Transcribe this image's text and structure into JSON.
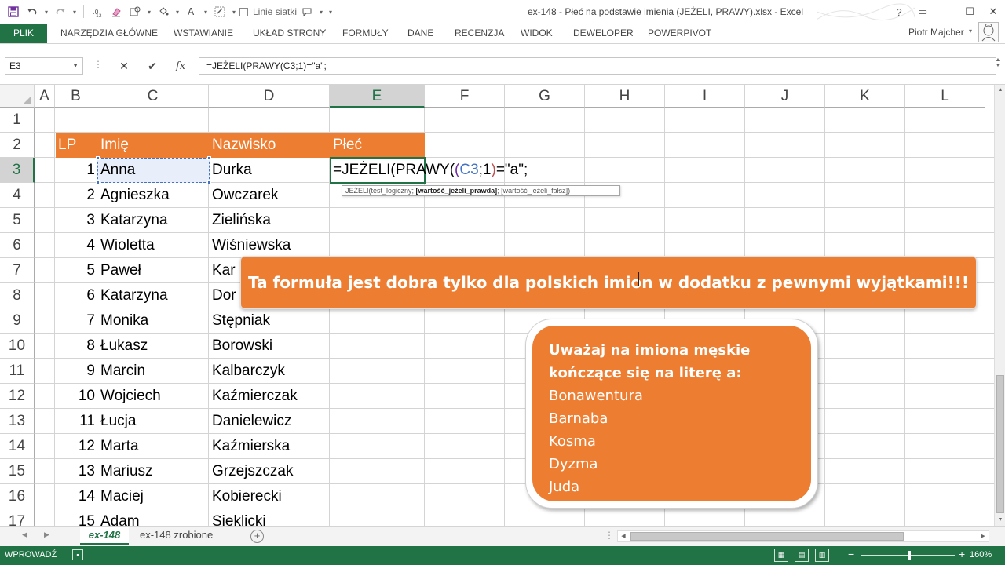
{
  "window": {
    "title": "ex-148 - Płeć na podstawie imienia (JEŻELI, PRAWY).xlsx - Excel",
    "controls": {
      "help": "?",
      "ribbon_display": "▭",
      "minimize": "—",
      "restore": "☐",
      "close": "✕"
    }
  },
  "qat": {
    "icons": [
      "save-icon",
      "undo-icon",
      "redo-icon",
      "decimal-icon",
      "eraser-icon",
      "shapes-icon",
      "fill-icon",
      "font-color-icon",
      "border-icon",
      "gridlines-icon",
      "comment-icon",
      "customize-icon"
    ],
    "gridlines_label": "Linie siatki"
  },
  "ribbon": {
    "file_tab": "PLIK",
    "tabs": [
      "NARZĘDZIA GŁÓWNE",
      "WSTAWIANIE",
      "UKŁAD STRONY",
      "FORMUŁY",
      "DANE",
      "RECENZJA",
      "WIDOK",
      "DEWELOPER",
      "POWERPIVOT"
    ],
    "user": "Piotr Majcher"
  },
  "formula_bar": {
    "name_box": "E3",
    "cancel": "✕",
    "enter": "✔",
    "fx": "fx",
    "content": "=JEŻELI(PRAWY(C3;1)=\"a\";"
  },
  "columns": [
    "A",
    "B",
    "C",
    "D",
    "E",
    "F",
    "G",
    "H",
    "I",
    "J",
    "K",
    "L"
  ],
  "rows": [
    "1",
    "2",
    "3",
    "4",
    "5",
    "6",
    "7",
    "8",
    "9",
    "10",
    "11",
    "12",
    "13",
    "14",
    "15",
    "16",
    "17"
  ],
  "selected": {
    "column": "E",
    "row": "3"
  },
  "table": {
    "headers": {
      "lp": "LP",
      "imie": "Imię",
      "nazwisko": "Nazwisko",
      "plec": "Płeć"
    },
    "records": [
      {
        "lp": "1",
        "imie": "Anna",
        "nazwisko": "Durka"
      },
      {
        "lp": "2",
        "imie": "Agnieszka",
        "nazwisko": "Owczarek"
      },
      {
        "lp": "3",
        "imie": "Katarzyna",
        "nazwisko": "Zielińska"
      },
      {
        "lp": "4",
        "imie": "Wioletta",
        "nazwisko": "Wiśniewska"
      },
      {
        "lp": "5",
        "imie": "Paweł",
        "nazwisko": "Kar"
      },
      {
        "lp": "6",
        "imie": "Katarzyna",
        "nazwisko": "Dor"
      },
      {
        "lp": "7",
        "imie": "Monika",
        "nazwisko": "Stępniak"
      },
      {
        "lp": "8",
        "imie": "Łukasz",
        "nazwisko": "Borowski"
      },
      {
        "lp": "9",
        "imie": "Marcin",
        "nazwisko": "Kalbarczyk"
      },
      {
        "lp": "10",
        "imie": "Wojciech",
        "nazwisko": "Kaźmierczak"
      },
      {
        "lp": "11",
        "imie": "Łucja",
        "nazwisko": "Danielewicz"
      },
      {
        "lp": "12",
        "imie": "Marta",
        "nazwisko": "Kaźmierska"
      },
      {
        "lp": "13",
        "imie": "Mariusz",
        "nazwisko": "Grzejszczak"
      },
      {
        "lp": "14",
        "imie": "Maciej",
        "nazwisko": "Kobierecki"
      },
      {
        "lp": "15",
        "imie": "Adam",
        "nazwisko": "Sieklicki"
      }
    ]
  },
  "editing": {
    "f_start": "=JEŻELI(PRAWY(",
    "f_open": "(",
    "f_ref": "C3",
    "f_mid": ";1",
    "f_close": ")",
    "f_end": "=\"a\";",
    "tooltip_start": "JEŻELI(test_logiczny; ",
    "tooltip_bold": "[wartość_jeżeli_prawda]",
    "tooltip_end": "; [wartość_jeżeli_fałsz])"
  },
  "banner": "Ta formuła jest dobra tylko dla polskich imion w dodatku z pewnymi wyjątkami!!!",
  "tip": {
    "heading_line1": "Uważaj na imiona męskie",
    "heading_line2": "kończące się na literę a:",
    "names": [
      "Bonawentura",
      "Barnaba",
      "Kosma",
      "Dyzma",
      "Juda"
    ]
  },
  "sheets": {
    "active": "ex-148",
    "other": "ex-148 zrobione",
    "add": "+"
  },
  "status": {
    "mode": "WPROWADŹ",
    "zoom": "160%"
  },
  "colors": {
    "accent": "#217346",
    "orange": "#ed7d31",
    "ref_blue": "#4472c4"
  }
}
